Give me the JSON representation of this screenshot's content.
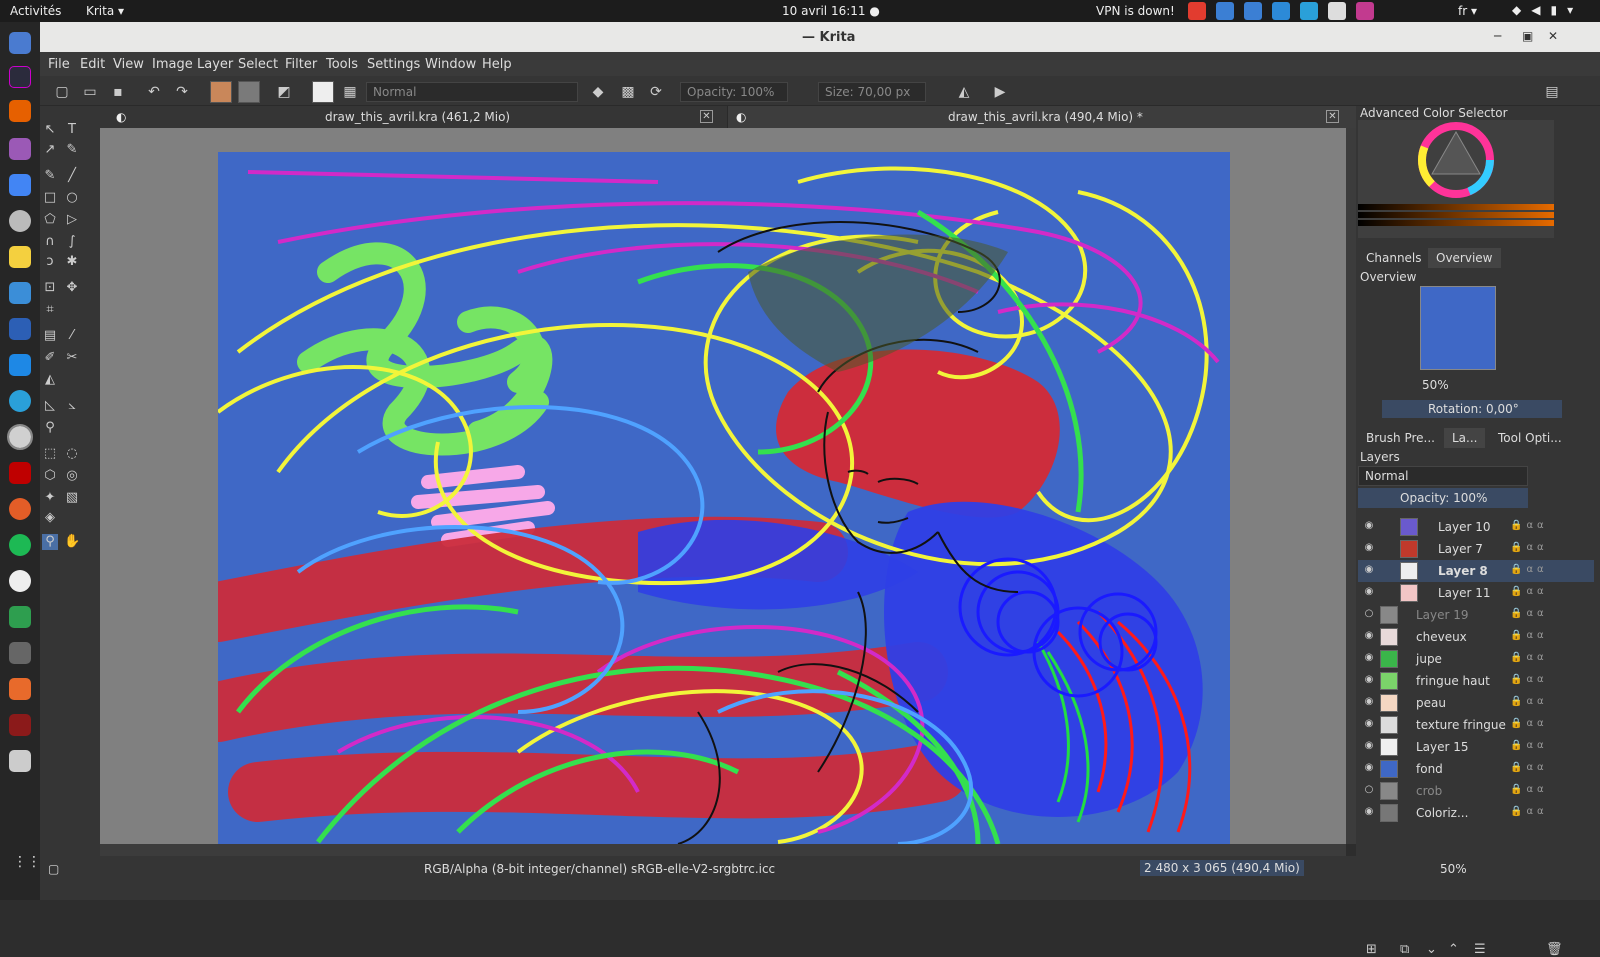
{
  "topbar": {
    "activities": "Activités",
    "app_menu": "Krita ▾",
    "clock": "10 avril  16:11 ●",
    "vpn": "VPN is down!",
    "language": "fr ▾",
    "tray_colors": [
      "#e23c2f",
      "#3b7fd4",
      "#3b7fd4",
      "#2c8ad8",
      "#2aa0d9",
      "#dddddd",
      "#c23a8f"
    ]
  },
  "window": {
    "title": "— Krita",
    "menu": [
      "File",
      "Edit",
      "View",
      "Image",
      "Layer",
      "Select",
      "Filter",
      "Tools",
      "Settings",
      "Window",
      "Help"
    ]
  },
  "toolbar": {
    "blend_mode": "Normal",
    "opacity": "Opacity: 100%",
    "size": "Size: 70,00 px",
    "fg_color": "#c9875a",
    "bg_color": "#7a7a7a"
  },
  "tabs": [
    {
      "label": "draw_this_avril.kra (461,2 Mio)"
    },
    {
      "label": "draw_this_avril.kra (490,4 Mio) *"
    }
  ],
  "status": {
    "color_space": "RGB/Alpha (8-bit integer/channel)  sRGB-elle-V2-srgbtrc.icc",
    "dimensions": "2 480 x 3 065 (490,4 Mio)",
    "zoom": "50%"
  },
  "panel": {
    "color_selector_title": "Advanced Color Selector",
    "tab_channels": "Channels",
    "tab_overview": "Overview",
    "overview_title": "Overview",
    "overview_zoom": "50%",
    "rotation": "Rotation: 0,00°",
    "dock_tabs": [
      "Brush Pre...",
      "La...",
      "Tool Opti..."
    ],
    "layers_title": "Layers",
    "layers_blend": "Normal",
    "layers_opacity": "Opacity:  100%",
    "layers": [
      {
        "name": "Layer 10",
        "visible": true,
        "selected": false,
        "thumb": "#6a5acd"
      },
      {
        "name": "Layer 7",
        "visible": true,
        "selected": false,
        "thumb": "#c0392b"
      },
      {
        "name": "Layer 8",
        "visible": true,
        "selected": true,
        "thumb": "#eeeeee"
      },
      {
        "name": "Layer 11",
        "visible": true,
        "selected": false,
        "thumb": "#f2c6c6"
      },
      {
        "name": "Layer 19",
        "visible": false,
        "selected": false,
        "thumb": "#888888"
      },
      {
        "name": "cheveux",
        "visible": true,
        "selected": false,
        "thumb": "#e8dada"
      },
      {
        "name": "jupe",
        "visible": true,
        "selected": false,
        "thumb": "#3ab54a"
      },
      {
        "name": "fringue haut",
        "visible": true,
        "selected": false,
        "thumb": "#7bd36a"
      },
      {
        "name": "peau",
        "visible": true,
        "selected": false,
        "thumb": "#f4d7c2"
      },
      {
        "name": "texture fringue",
        "visible": true,
        "selected": false,
        "thumb": "#dcdcdc"
      },
      {
        "name": "Layer 15",
        "visible": true,
        "selected": false,
        "thumb": "#f0f0f0"
      },
      {
        "name": "fond",
        "visible": true,
        "selected": false,
        "thumb": "#3f68c6"
      },
      {
        "name": "crob",
        "visible": false,
        "selected": false,
        "thumb": "#888888"
      },
      {
        "name": "Coloriz...",
        "visible": true,
        "selected": false,
        "thumb": "#777777"
      }
    ]
  }
}
